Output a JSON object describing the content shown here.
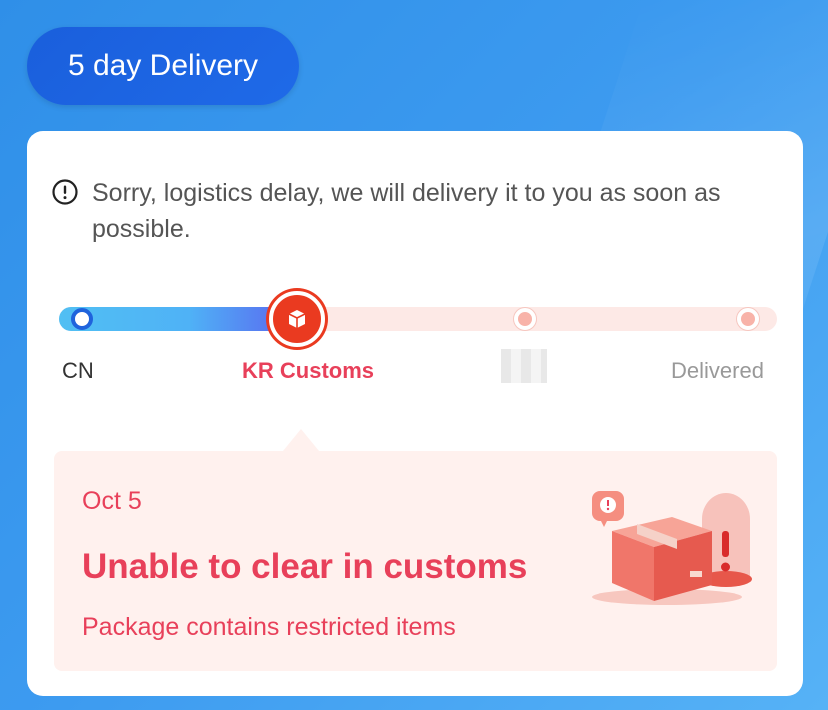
{
  "header": {
    "delivery_label": "5 day Delivery"
  },
  "notice": {
    "icon": "exclamation-circle-icon",
    "text": "Sorry, logistics delay, we will delivery it to you as soon as possible."
  },
  "progress": {
    "steps": [
      {
        "label": "CN",
        "state": "done"
      },
      {
        "label": "KR Customs",
        "state": "current",
        "icon": "box-icon"
      },
      {
        "label": "",
        "state": "pending"
      },
      {
        "label": "Delivered",
        "state": "pending"
      }
    ],
    "colors": {
      "active": "#e8405a",
      "done": "#1f63dc",
      "pending": "#f8b3a9"
    }
  },
  "status": {
    "date": "Oct 5",
    "title": "Unable to clear in customs",
    "description": "Package contains restricted items",
    "illustration": "package-alert-illustration"
  },
  "colors": {
    "accent": "#e8405a",
    "pill": "#1a5fdc",
    "background": "#3d9bf0"
  }
}
